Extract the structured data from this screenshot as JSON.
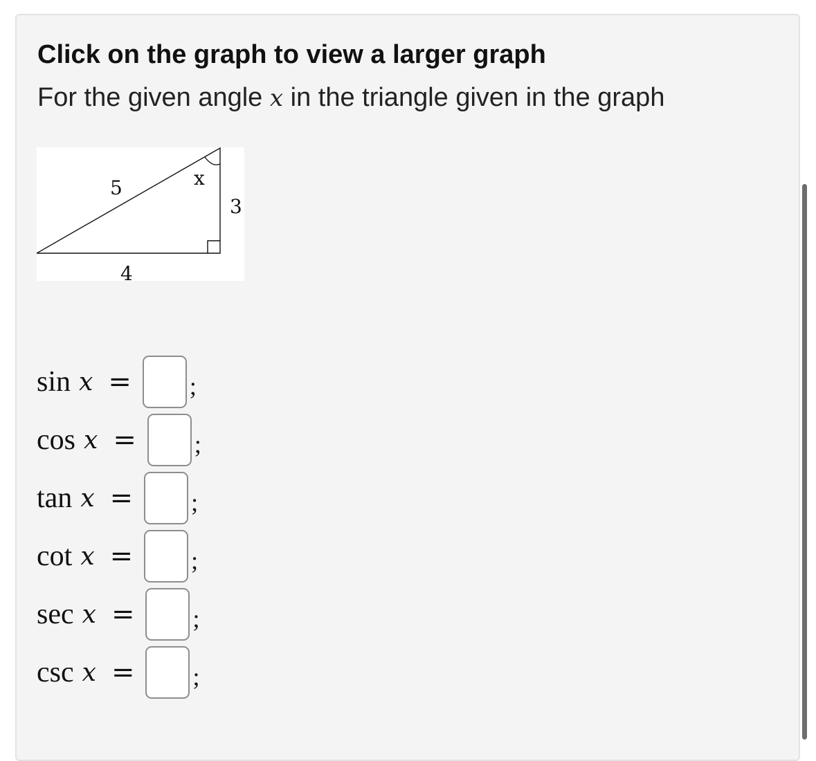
{
  "header": {
    "title": "Click on the graph to view a larger graph",
    "prompt_before": "For the given angle ",
    "prompt_var": "x",
    "prompt_after": " in the triangle given in the graph"
  },
  "graph": {
    "hypotenuse_label": "5",
    "vertical_label": "3",
    "base_label": "4",
    "angle_label": "x"
  },
  "equations": [
    {
      "fn": "sin",
      "var": "x",
      "equals": "=",
      "value": "",
      "sep": ";"
    },
    {
      "fn": "cos",
      "var": "x",
      "equals": "=",
      "value": "",
      "sep": ";"
    },
    {
      "fn": "tan",
      "var": "x",
      "equals": "=",
      "value": "",
      "sep": ";"
    },
    {
      "fn": "cot",
      "var": "x",
      "equals": "=",
      "value": "",
      "sep": ";"
    },
    {
      "fn": "sec",
      "var": "x",
      "equals": "=",
      "value": "",
      "sep": ";"
    },
    {
      "fn": "csc",
      "var": "x",
      "equals": "=",
      "value": "",
      "sep": ";"
    }
  ]
}
